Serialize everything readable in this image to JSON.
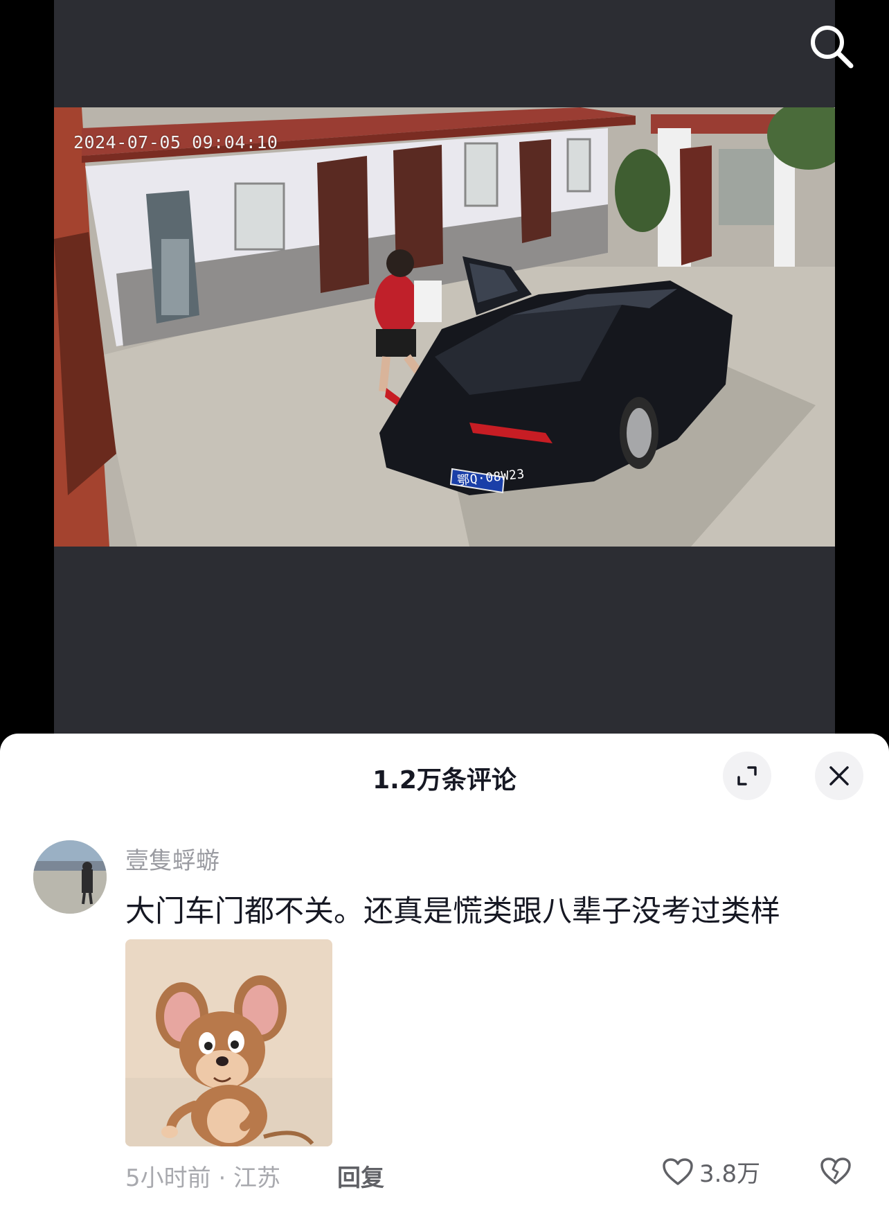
{
  "video": {
    "timestamp": "2024-07-05 09:04:10",
    "plate_text": "鄂Q·08W23",
    "search_icon": "search-icon"
  },
  "comments_panel": {
    "title": "1.2万条评论",
    "expand_icon": "expand-icon",
    "close_icon": "close-icon",
    "comment": {
      "username": "壹隻蜉蝣",
      "text": "大门车门都不关。还真是慌类跟八辈子没考过类样",
      "sticker": "jerry-mouse-sticker",
      "time_location": "5小时前 · 江苏",
      "reply_label": "回复",
      "like_count": "3.8万",
      "like_icon": "heart-outline-icon",
      "dislike_icon": "broken-heart-icon"
    }
  },
  "colors": {
    "video_bg": "#2c2d33",
    "sheet_bg": "#ffffff",
    "title_text": "#161823",
    "meta_text": "#a8a9ae"
  }
}
